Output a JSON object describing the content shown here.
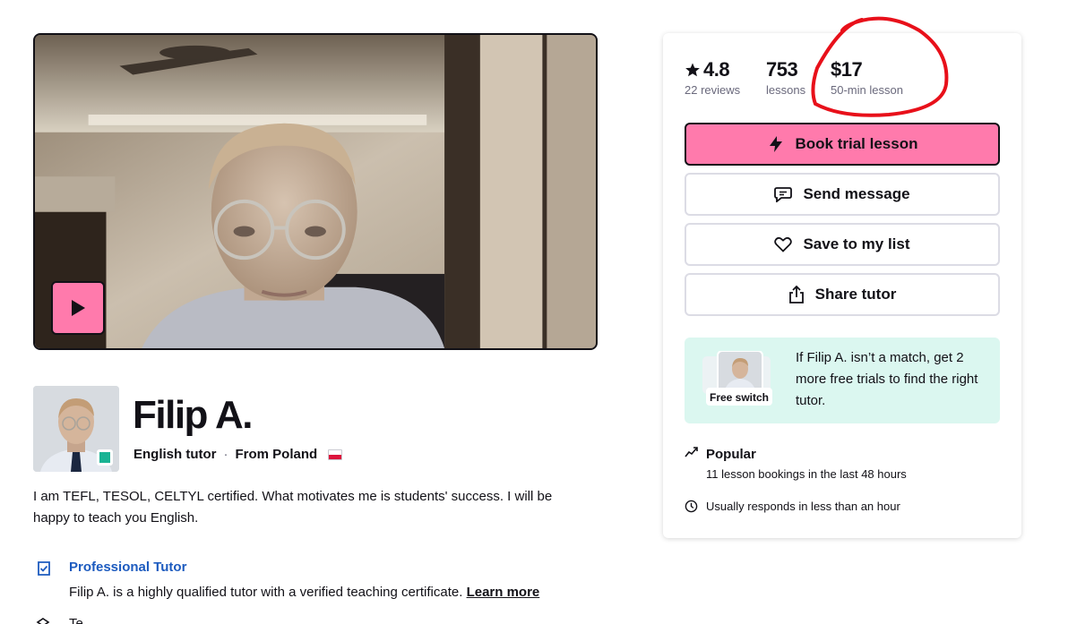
{
  "profile": {
    "name": "Filip A.",
    "role": "English tutor",
    "separator": "·",
    "origin": "From Poland",
    "bio": "I am TEFL, TESOL, CELTYL certified. What motivates me is students' success. I will be happy to teach you English.",
    "badge_title": "Professional Tutor",
    "badge_desc": "Filip A. is a highly qualified tutor with a verified teaching certificate.",
    "badge_link": "Learn more",
    "next_item": "Te"
  },
  "stats": {
    "rating": "4.8",
    "rating_label": "22 reviews",
    "lessons": "753",
    "lessons_label": "lessons",
    "price": "$17",
    "price_label": "50-min lesson"
  },
  "actions": {
    "book": "Book trial lesson",
    "message": "Send message",
    "save": "Save to my list",
    "share": "Share tutor"
  },
  "free_switch": {
    "tag": "Free switch",
    "text": "If Filip A. isn’t a match, get 2 more free trials to find the right tutor."
  },
  "popular": {
    "title": "Popular",
    "desc": "11 lesson bookings in the last 48 hours"
  },
  "response": {
    "text": "Usually responds in less than an hour"
  },
  "colors": {
    "accent": "#ff7aac",
    "link": "#1d5bbf",
    "free_bg": "#dbf7f0",
    "online": "#1ab394",
    "annotation": "#e8101a"
  }
}
